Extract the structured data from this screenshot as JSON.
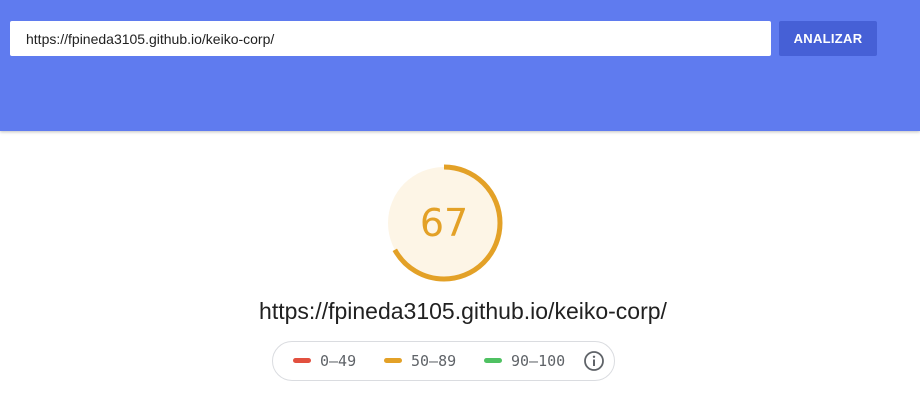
{
  "search": {
    "url_value": "https://fpineda3105.github.io/keiko-corp/",
    "analyze_label": "ANALIZAR"
  },
  "result": {
    "score": "67",
    "score_fraction": 0.67,
    "url": "https://fpineda3105.github.io/keiko-corp/"
  },
  "legend": {
    "items": [
      {
        "label": "0–49",
        "color": "#e2503f"
      },
      {
        "label": "50–89",
        "color": "#e3a127"
      },
      {
        "label": "90–100",
        "color": "#4fc162"
      }
    ],
    "info_icon": "info-icon"
  },
  "colors": {
    "header_bg": "#5f7bef",
    "button_bg": "#4660d6",
    "gauge_accent": "#e3a127",
    "gauge_fill": "#fdf5e6"
  }
}
